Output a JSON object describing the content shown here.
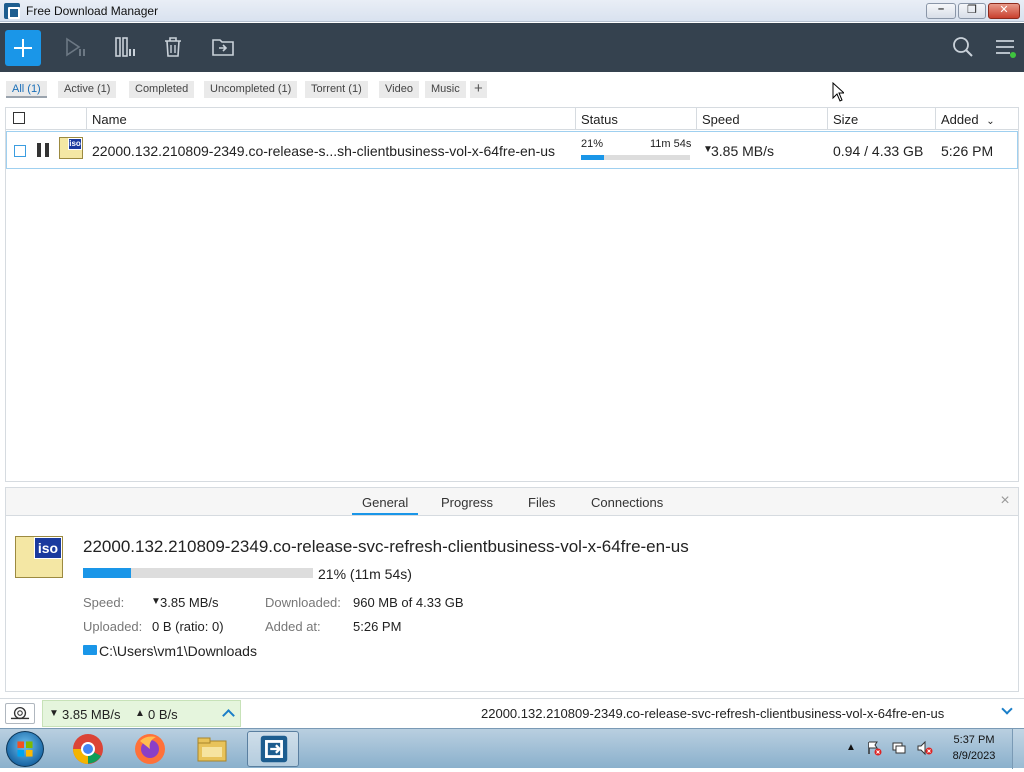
{
  "window": {
    "title": "Free Download Manager"
  },
  "toolbar": {
    "buttons": [
      "add-icon",
      "resume-icon",
      "pause-all-icon",
      "delete-icon",
      "move-folder-icon",
      "search-icon",
      "menu-icon"
    ]
  },
  "filters": [
    {
      "label": "All (1)",
      "active": true
    },
    {
      "label": "Active (1)",
      "active": false
    },
    {
      "label": "Completed",
      "active": false
    },
    {
      "label": "Uncompleted (1)",
      "active": false
    },
    {
      "label": "Torrent (1)",
      "active": false
    },
    {
      "label": "Video",
      "active": false
    },
    {
      "label": "Music",
      "active": false
    }
  ],
  "list": {
    "columns": [
      "Name",
      "Status",
      "Speed",
      "Size",
      "Added"
    ],
    "rows": [
      {
        "name": "22000.132.210809-2349.co-release-s...sh-clientbusiness-vol-x-64fre-en-us",
        "icon_label": "iso",
        "percent_text": "21%",
        "progress": 0.21,
        "eta": "11m 54s",
        "speed": "3.85 MB/s",
        "size": "0.94 / 4.33 GB",
        "added": "5:26 PM"
      }
    ]
  },
  "details": {
    "tabs": [
      "General",
      "Progress",
      "Files",
      "Connections"
    ],
    "active_tab": "General",
    "icon_label": "iso",
    "filename": "22000.132.210809-2349.co-release-svc-refresh-clientbusiness-vol-x-64fre-en-us",
    "progress": 0.21,
    "progress_text": "21% (11m 54s)",
    "speed_label": "Speed:",
    "speed_value": "3.85 MB/s",
    "downloaded_label": "Downloaded:",
    "downloaded_value": "960 MB of 4.33 GB",
    "uploaded_label": "Uploaded:",
    "uploaded_value": "0 B (ratio: 0)",
    "added_label": "Added at:",
    "added_value": "5:26 PM",
    "path": "C:\\Users\\vm1\\Downloads"
  },
  "statusbar": {
    "down_speed": "3.85 MB/s",
    "up_speed": "0 B/s",
    "current_file": "22000.132.210809-2349.co-release-svc-refresh-clientbusiness-vol-x-64fre-en-us"
  },
  "taskbar": {
    "apps": [
      "chrome-icon",
      "firefox-icon",
      "file-explorer-icon",
      "free-download-manager-icon"
    ],
    "time": "5:37 PM",
    "date": "8/9/2023"
  },
  "colors": {
    "accent": "#1a96e8",
    "toolbar_bg": "#35424f",
    "row_border": "#9fd0f0",
    "speed_bg": "#e5f5dd"
  }
}
